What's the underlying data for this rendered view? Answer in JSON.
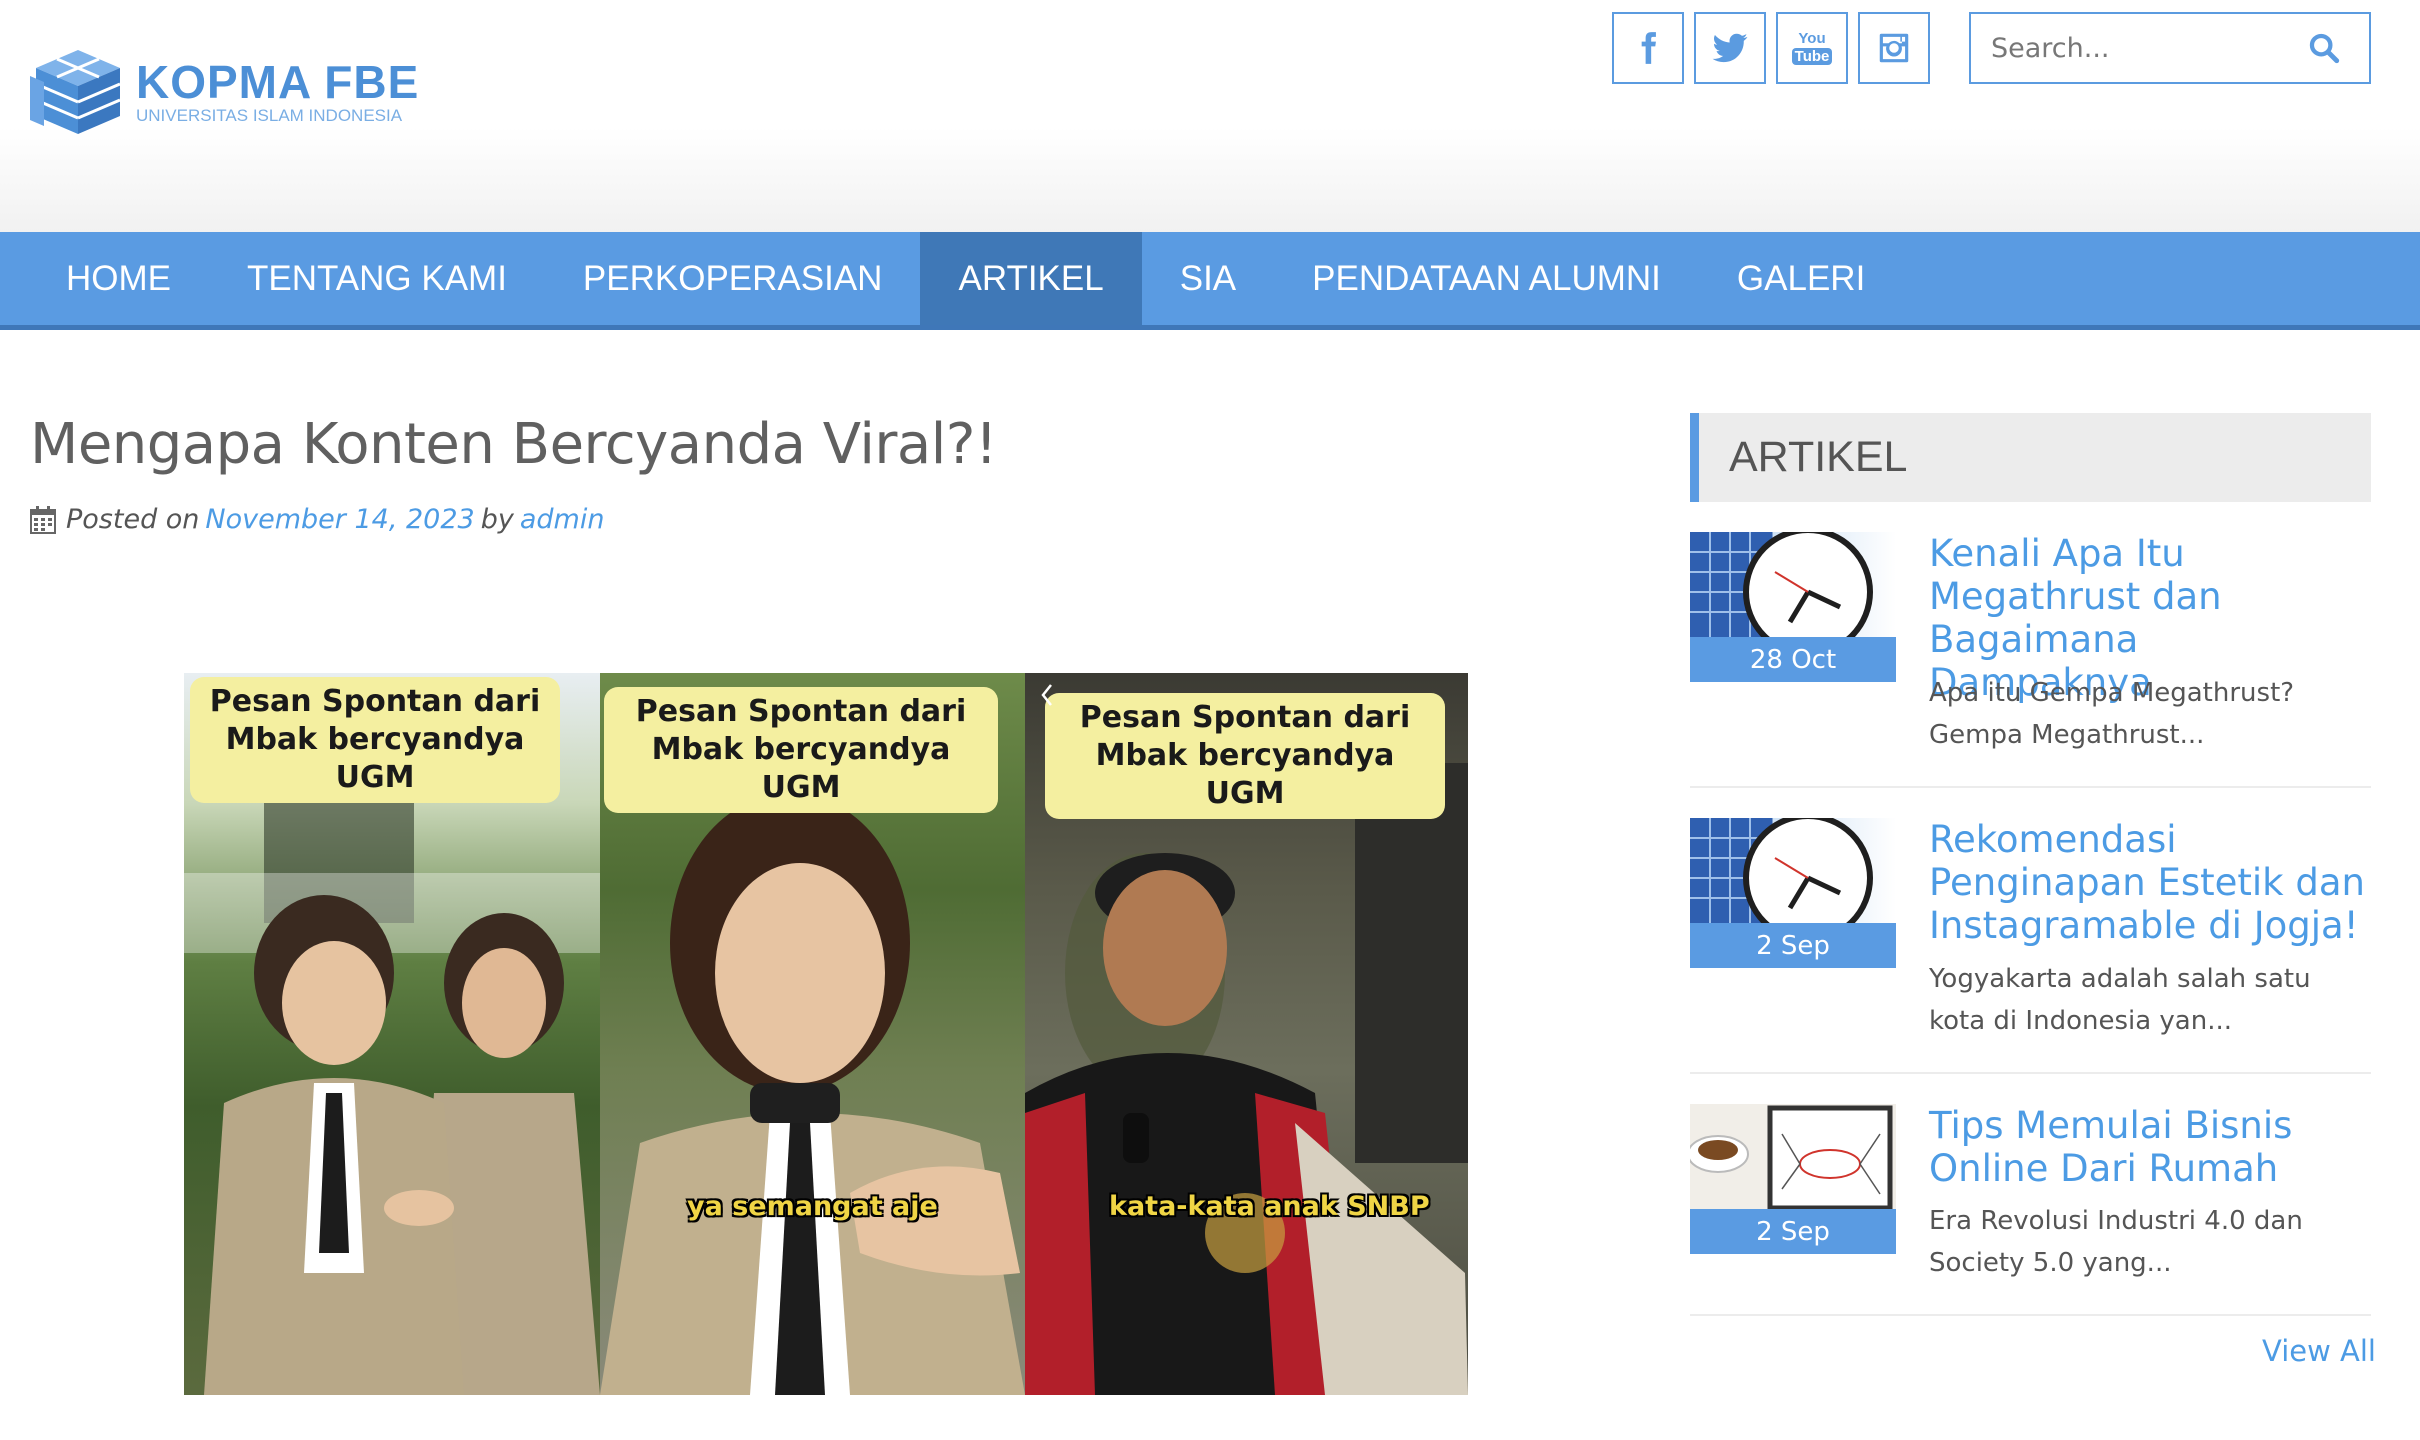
{
  "brand": {
    "title": "KOPMA FBE",
    "subtitle": "UNIVERSITAS ISLAM INDONESIA"
  },
  "social": [
    {
      "name": "facebook-icon"
    },
    {
      "name": "twitter-icon"
    },
    {
      "name": "youtube-icon",
      "label_top": "You",
      "label_bottom": "Tube"
    },
    {
      "name": "instagram-icon"
    }
  ],
  "search": {
    "placeholder": "Search..."
  },
  "nav": {
    "items": [
      "HOME",
      "TENTANG KAMI",
      "PERKOPERASIAN",
      "ARTIKEL",
      "SIA",
      "PENDATAAN ALUMNI",
      "GALERI"
    ],
    "active": "ARTIKEL"
  },
  "post": {
    "title": "Mengapa Konten Bercyanda Viral?!",
    "posted_on": "Posted on",
    "date": "November 14, 2023",
    "by": "by",
    "author": "admin",
    "image": {
      "captions": [
        "Pesan Spontan dari Mbak bercyandya UGM",
        "Pesan Spontan dari Mbak bercyandya UGM",
        "Pesan Spontan dari Mbak bercyandya UGM"
      ],
      "subtitles": [
        "ya semangat aje",
        "kata-kata anak SNBP"
      ]
    }
  },
  "sidebar": {
    "title": "ARTIKEL",
    "items": [
      {
        "title": "Kenali Apa Itu Megathrust dan Bagaimana Dampaknya",
        "date": "28 Oct",
        "excerpt": "Apa itu Gempa Megathrust? Gempa Megathrust..."
      },
      {
        "title": "Rekomendasi Penginapan Estetik dan Instagramable di Jogja!",
        "date": "2 Sep",
        "excerpt": "Yogyakarta adalah salah satu kota di Indonesia yan..."
      },
      {
        "title": "Tips Memulai Bisnis Online Dari Rumah",
        "date": "2 Sep",
        "excerpt": "Era Revolusi Industri 4.0 dan Society 5.0 yang..."
      }
    ],
    "view_all": "View All"
  },
  "colors": {
    "accent": "#5a9be2",
    "nav_active": "#3f78b7",
    "link": "#4c9be4"
  }
}
